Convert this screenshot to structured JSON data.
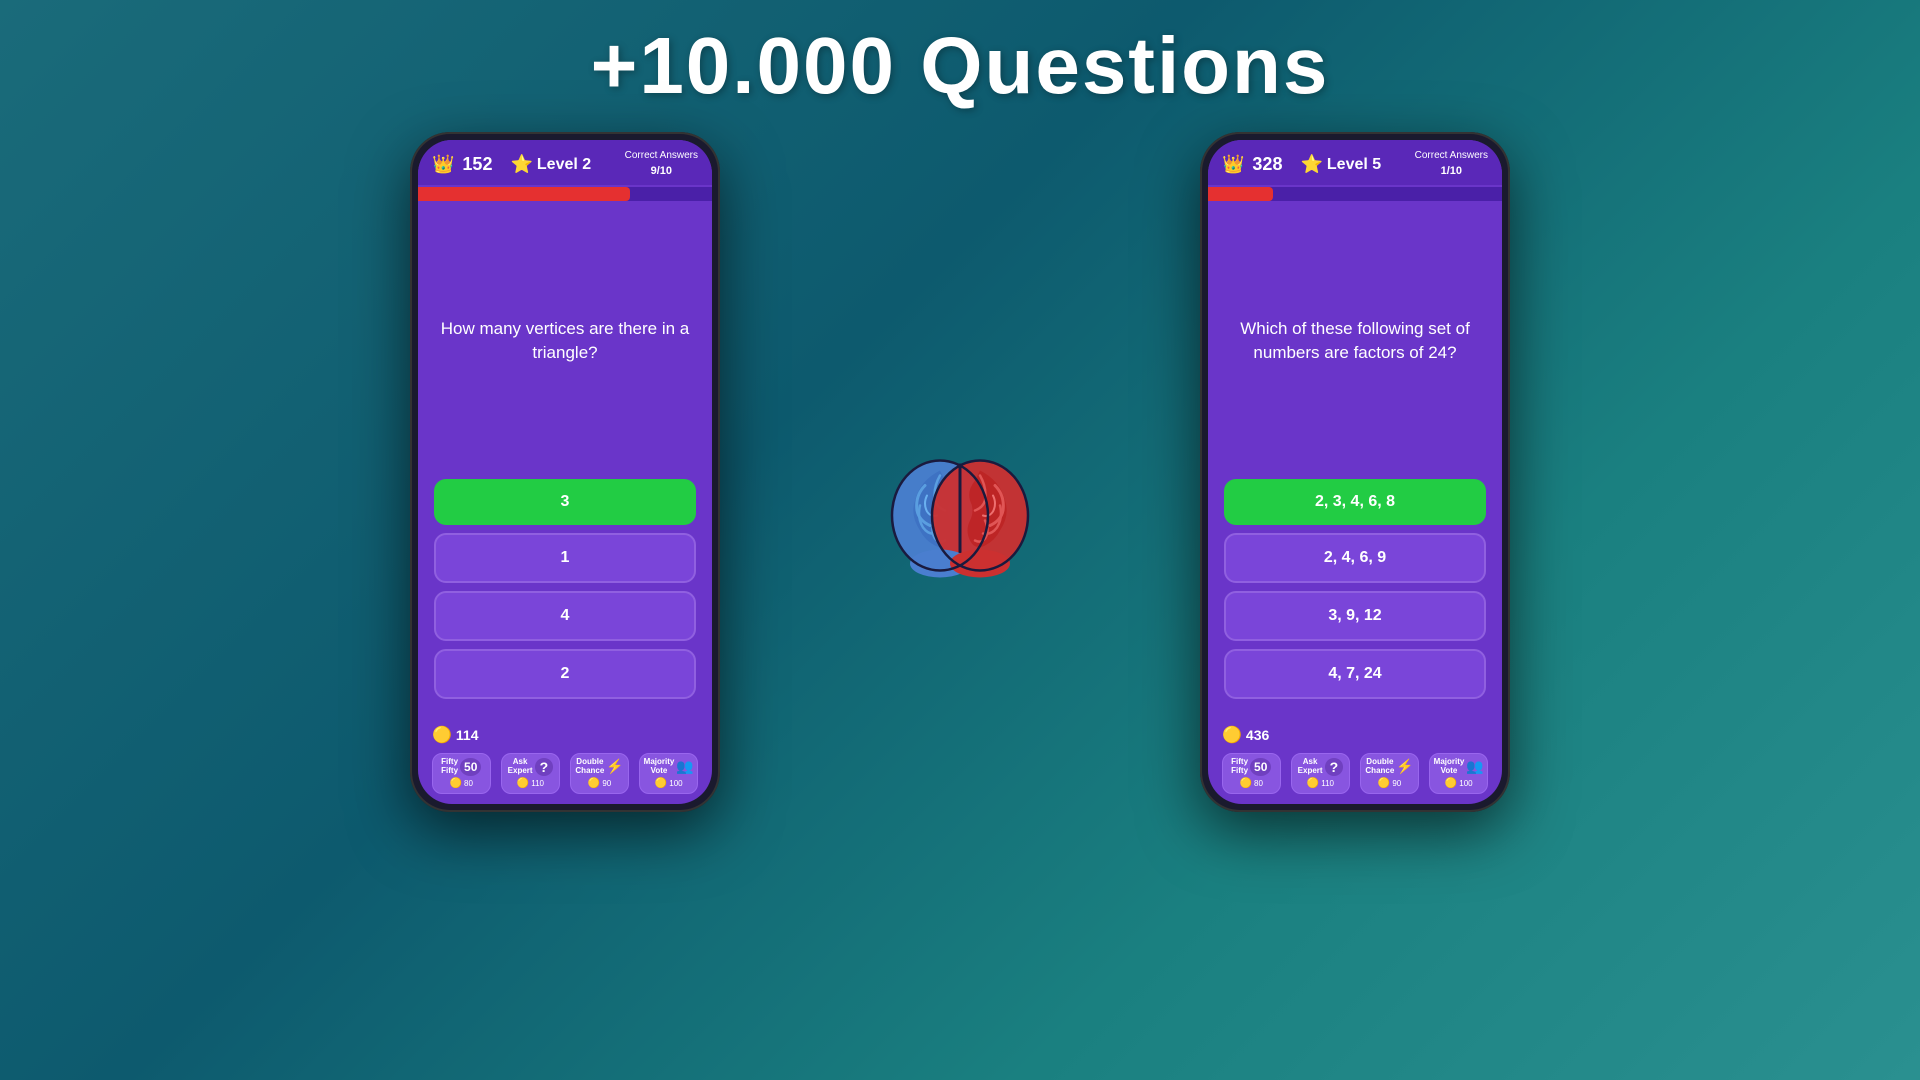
{
  "header": {
    "title": "+10.000 Questions"
  },
  "phone1": {
    "score": "152",
    "level": "Level  2",
    "correct_answers_label": "Correct Answers",
    "correct_answers_value": "9/10",
    "progress_width": "72%",
    "question": "How many vertices are there in a triangle?",
    "answers": [
      {
        "text": "3",
        "type": "correct"
      },
      {
        "text": "1",
        "type": "normal"
      },
      {
        "text": "4",
        "type": "normal"
      },
      {
        "text": "2",
        "type": "normal"
      }
    ],
    "coins": "114",
    "lifelines": [
      {
        "label": "Fifty Fifty",
        "icon": "50",
        "cost": "80"
      },
      {
        "label": "Ask Expert",
        "icon": "?",
        "cost": "110"
      },
      {
        "label": "Double Chance",
        "icon": "⚡",
        "cost": "90"
      },
      {
        "label": "Majority Vote",
        "icon": "👥",
        "cost": "100"
      }
    ]
  },
  "phone2": {
    "score": "328",
    "level": "Level  5",
    "correct_answers_label": "Correct Answers",
    "correct_answers_value": "1/10",
    "progress_width": "22%",
    "question": "Which of these following set of numbers are factors of 24?",
    "answers": [
      {
        "text": "2, 3, 4, 6, 8",
        "type": "correct"
      },
      {
        "text": "2, 4, 6, 9",
        "type": "normal"
      },
      {
        "text": "3, 9, 12",
        "type": "normal"
      },
      {
        "text": "4, 7, 24",
        "type": "normal"
      }
    ],
    "coins": "436",
    "lifelines": [
      {
        "label": "Fifty Fifty",
        "icon": "50",
        "cost": "80"
      },
      {
        "label": "Ask Expert",
        "icon": "?",
        "cost": "110"
      },
      {
        "label": "Double Chance",
        "icon": "⚡",
        "cost": "90"
      },
      {
        "label": "Majority Vote",
        "icon": "👥",
        "cost": "100"
      }
    ]
  }
}
